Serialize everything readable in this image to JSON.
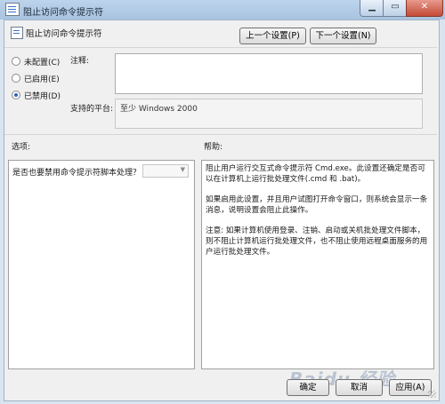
{
  "window": {
    "title": "阻止访问命令提示符"
  },
  "header": {
    "policy_title": "阻止访问命令提示符",
    "prev_label": "上一个设置(P)",
    "next_label": "下一个设置(N)"
  },
  "state": {
    "options": [
      {
        "label": "未配置(C)",
        "selected": false
      },
      {
        "label": "已启用(E)",
        "selected": false
      },
      {
        "label": "已禁用(D)",
        "selected": true
      }
    ]
  },
  "comment": {
    "label": "注释:",
    "value": ""
  },
  "platform": {
    "label": "支持的平台:",
    "value": "至少 Windows 2000"
  },
  "options_section": {
    "label": "选项:",
    "question": "是否也要禁用命令提示符脚本处理？",
    "dropdown_value": ""
  },
  "help_section": {
    "label": "帮助:",
    "paragraphs": [
      "阻止用户运行交互式命令提示符 Cmd.exe。此设置还确定是否可以在计算机上运行批处理文件(.cmd 和 .bat)。",
      "如果启用此设置，并且用户试图打开命令窗口，则系统会显示一条消息，说明设置会阻止此操作。",
      "注意: 如果计算机使用登录、注销、启动或关机批处理文件脚本，则不阻止计算机运行批处理文件，也不阻止使用远程桌面服务的用户运行批处理文件。"
    ]
  },
  "footer": {
    "ok_label": "确定",
    "cancel_label": "取消",
    "apply_label": "应用(A)"
  },
  "watermark": "Baidu 经验",
  "colors": {
    "accent": "#2f64b8",
    "titlebar": "#bcd4ec",
    "close": "#c44a36"
  }
}
